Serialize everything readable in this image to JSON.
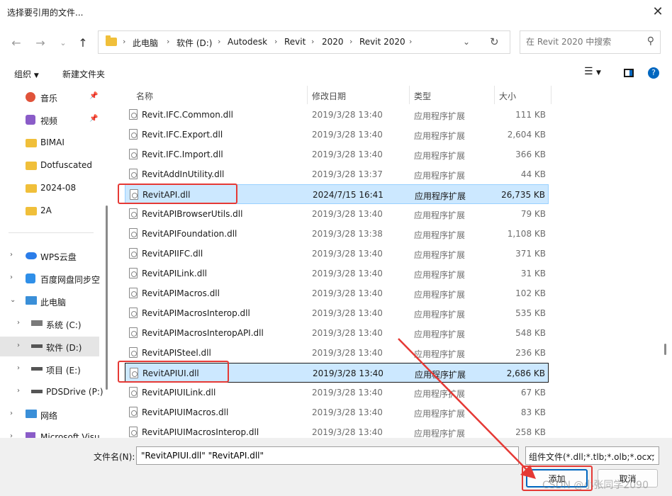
{
  "window": {
    "title": "选择要引用的文件..."
  },
  "toolbar": {
    "breadcrumb": [
      "此电脑",
      "软件 (D:)",
      "Autodesk",
      "Revit",
      "2020",
      "Revit 2020"
    ],
    "search_placeholder": "在 Revit 2020 中搜索"
  },
  "cmdbar": {
    "organize": "组织",
    "new_folder": "新建文件夹"
  },
  "sidebar": {
    "items": [
      {
        "label": "音乐",
        "icon": "music-icon",
        "pinned": true
      },
      {
        "label": "视频",
        "icon": "video-icon",
        "pinned": true
      },
      {
        "label": "BIMAI",
        "icon": "folder-icon"
      },
      {
        "label": "Dotfuscated",
        "icon": "folder-icon"
      },
      {
        "label": "2024-08",
        "icon": "folder-icon"
      },
      {
        "label": "2A",
        "icon": "folder-icon"
      },
      {
        "label": "WPS云盘",
        "icon": "cloud-icon"
      },
      {
        "label": "百度网盘同步空",
        "icon": "baidu-icon"
      },
      {
        "label": "此电脑",
        "icon": "computer-icon"
      },
      {
        "label": "系统 (C:)",
        "icon": "windows-drive-icon"
      },
      {
        "label": "软件 (D:)",
        "icon": "drive-icon",
        "selected": true
      },
      {
        "label": "项目 (E:)",
        "icon": "drive-icon"
      },
      {
        "label": "PDSDrive (P:)",
        "icon": "drive-icon"
      },
      {
        "label": "网络",
        "icon": "network-icon"
      },
      {
        "label": "Microsoft Visu",
        "icon": "vs-icon"
      }
    ]
  },
  "columns": {
    "name": "名称",
    "date": "修改日期",
    "type": "类型",
    "size": "大小"
  },
  "files": [
    {
      "name": "Revit.IFC.Common.dll",
      "date": "2019/3/28 13:40",
      "type": "应用程序扩展",
      "size": "111 KB"
    },
    {
      "name": "Revit.IFC.Export.dll",
      "date": "2019/3/28 13:40",
      "type": "应用程序扩展",
      "size": "2,604 KB"
    },
    {
      "name": "Revit.IFC.Import.dll",
      "date": "2019/3/28 13:40",
      "type": "应用程序扩展",
      "size": "366 KB"
    },
    {
      "name": "RevitAddInUtility.dll",
      "date": "2019/3/28 13:37",
      "type": "应用程序扩展",
      "size": "44 KB"
    },
    {
      "name": "RevitAPI.dll",
      "date": "2024/7/15 16:41",
      "type": "应用程序扩展",
      "size": "26,735 KB",
      "selected": true
    },
    {
      "name": "RevitAPIBrowserUtils.dll",
      "date": "2019/3/28 13:40",
      "type": "应用程序扩展",
      "size": "79 KB"
    },
    {
      "name": "RevitAPIFoundation.dll",
      "date": "2019/3/28 13:38",
      "type": "应用程序扩展",
      "size": "1,108 KB"
    },
    {
      "name": "RevitAPIIFC.dll",
      "date": "2019/3/28 13:40",
      "type": "应用程序扩展",
      "size": "371 KB"
    },
    {
      "name": "RevitAPILink.dll",
      "date": "2019/3/28 13:40",
      "type": "应用程序扩展",
      "size": "31 KB"
    },
    {
      "name": "RevitAPIMacros.dll",
      "date": "2019/3/28 13:40",
      "type": "应用程序扩展",
      "size": "102 KB"
    },
    {
      "name": "RevitAPIMacrosInterop.dll",
      "date": "2019/3/28 13:40",
      "type": "应用程序扩展",
      "size": "535 KB"
    },
    {
      "name": "RevitAPIMacrosInteropAPI.dll",
      "date": "2019/3/28 13:40",
      "type": "应用程序扩展",
      "size": "548 KB"
    },
    {
      "name": "RevitAPISteel.dll",
      "date": "2019/3/28 13:40",
      "type": "应用程序扩展",
      "size": "236 KB"
    },
    {
      "name": "RevitAPIUI.dll",
      "date": "2019/3/28 13:40",
      "type": "应用程序扩展",
      "size": "2,686 KB",
      "selected": true,
      "focused": true
    },
    {
      "name": "RevitAPIUILink.dll",
      "date": "2019/3/28 13:40",
      "type": "应用程序扩展",
      "size": "67 KB"
    },
    {
      "name": "RevitAPIUIMacros.dll",
      "date": "2019/3/28 13:40",
      "type": "应用程序扩展",
      "size": "83 KB"
    },
    {
      "name": "RevitAPIUIMacrosInterop.dll",
      "date": "2019/3/28 13:40",
      "type": "应用程序扩展",
      "size": "258 KB"
    }
  ],
  "footer": {
    "filename_label": "文件名(N):",
    "filename_value": "\"RevitAPIUI.dll\" \"RevitAPI.dll\"",
    "filetype": "组件文件(*.dll;*.tlb;*.olb;*.ocx;",
    "add_button": "添加",
    "cancel_button": "取消"
  },
  "watermark": "CSDN @小张同学2090",
  "colors": {
    "selection": "#cce8ff",
    "annotation": "#e53935",
    "accent": "#0067c0"
  }
}
